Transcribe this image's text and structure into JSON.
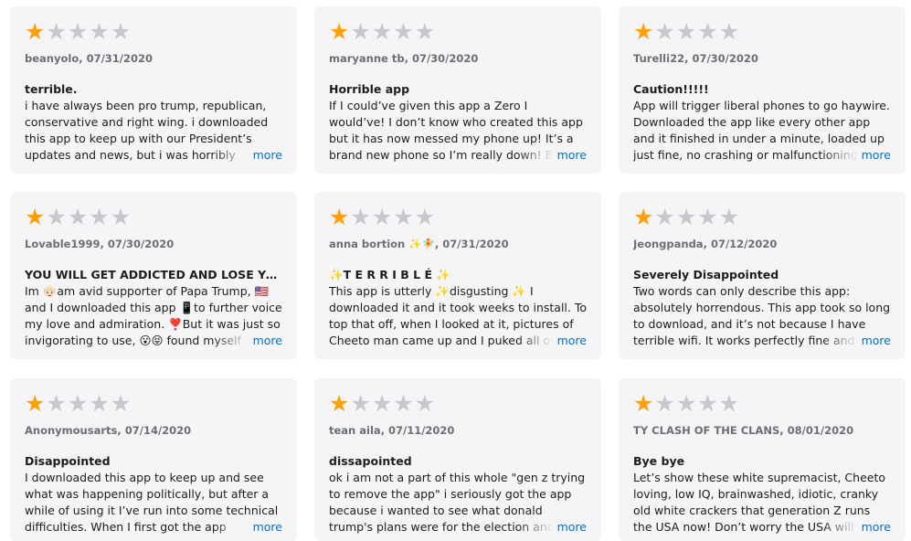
{
  "more_label": "more",
  "star_on_color": "#ff9f0a",
  "star_off_color": "#c7c7cc",
  "reviews": [
    {
      "rating": 1,
      "author_date": "beanyolo, 07/31/2020",
      "title": "terrible.",
      "body": "i have always been pro trump, republican, conservative and right wing. i downloaded this app to keep up with our President’s updates and news, but i was horribly disappointed"
    },
    {
      "rating": 1,
      "author_date": "maryanne tb, 07/30/2020",
      "title": "Horrible app",
      "body": "If I could’ve given this app a Zero I would’ve! I don’t know who created this app but it has now messed my phone up! It’s a brand new phone so I’m really down! Being an older"
    },
    {
      "rating": 1,
      "author_date": "Turelli22, 07/30/2020",
      "title": "Caution!!!!!",
      "body": "App will trigger liberal phones to go haywire. Downloaded the app like every other app and it finished in under a minute, loaded up just fine, no crashing or malfunctioning like"
    },
    {
      "rating": 1,
      "author_date": "Lovable1999, 07/30/2020",
      "title": "YOU WILL GET ADDICTED AND LOSE YOU...",
      "body": "Im 👴🏻am avid supporter of Papa Trump, 🇺🇸and I downloaded this app 📱to further voice my love and admiration. ❣️But it was just so invigorating to use, 😮😝 found myself"
    },
    {
      "rating": 1,
      "author_date": "anna bortion ✨🧚, 07/31/2020",
      "title": "✨T E R R I B L É ✨",
      "body": "This app is utterly ✨disgusting ✨ I downloaded it and it took weeks to install. To top that off, when I looked at it, pictures of Cheeto man came up and I puked all over"
    },
    {
      "rating": 1,
      "author_date": "Jeongpanda, 07/12/2020",
      "title": "Severely Disappointed",
      "body": "Two words can only describe this app: absolutely horrendous. This app took so long to download, and it’s not because I have terrible wifi. It works perfectly fine and my"
    },
    {
      "rating": 1,
      "author_date": "Anonymousarts, 07/14/2020",
      "title": "Disappointed",
      "body": "I downloaded this app to keep up and see what was happening politically, but after a while of using it I’ve run into some technical difficulties. When I first got the app"
    },
    {
      "rating": 1,
      "author_date": "tean aila, 07/11/2020",
      "title": "dissapointed",
      "body": "ok i am not a part of this whole \"gen z trying to remove the app\" i seriously got the app because i wanted to see what donald trump's plans were for the election and all that kind"
    },
    {
      "rating": 1,
      "author_date": "TY CLASH OF THE CLANS, 08/01/2020",
      "title": "Bye bye",
      "body": "Let’s show these white supremacist, Cheeto loving, low IQ, brainwashed, idiotic, cranky old white crackers that generation Z runs the USA now! Don’t worry the USA will be in much"
    }
  ]
}
